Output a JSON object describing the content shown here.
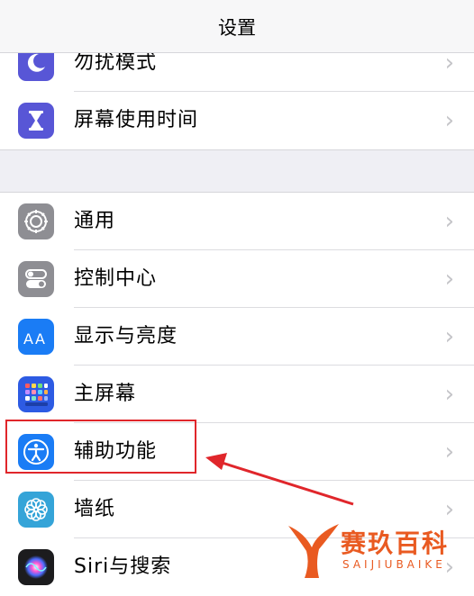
{
  "nav": {
    "title": "设置"
  },
  "group1": [
    {
      "name": "row-do-not-disturb",
      "icon": "moon-icon",
      "label": "勿扰模式",
      "color": "#5856d6"
    },
    {
      "name": "row-screen-time",
      "icon": "hourglass-icon",
      "label": "屏幕使用时间",
      "color": "#5856d6"
    }
  ],
  "group2": [
    {
      "name": "row-general",
      "icon": "gear-icon",
      "label": "通用",
      "color": "#8e8e93"
    },
    {
      "name": "row-control-center",
      "icon": "toggle-switches-icon",
      "label": "控制中心",
      "color": "#8e8e93"
    },
    {
      "name": "row-display-brightness",
      "icon": "text-size-icon",
      "label": "显示与亮度",
      "color": "#1a7cf5"
    },
    {
      "name": "row-home-screen",
      "icon": "app-grid-icon",
      "label": "主屏幕",
      "color": "#2d5be3"
    },
    {
      "name": "row-accessibility",
      "icon": "accessibility-icon",
      "label": "辅助功能",
      "color": "#1a7cf5"
    },
    {
      "name": "row-wallpaper",
      "icon": "flower-icon",
      "label": "墙纸",
      "color": "#35a4d8"
    },
    {
      "name": "row-siri-search",
      "icon": "siri-icon",
      "label": "Siri与搜索",
      "color": "#1c1c1e"
    }
  ],
  "chevron": "›",
  "watermark": {
    "text": "赛玖百科",
    "sub": "SAIJIUBAIKE",
    "color": "#e95a21"
  },
  "highlight_color": "#e0262b"
}
